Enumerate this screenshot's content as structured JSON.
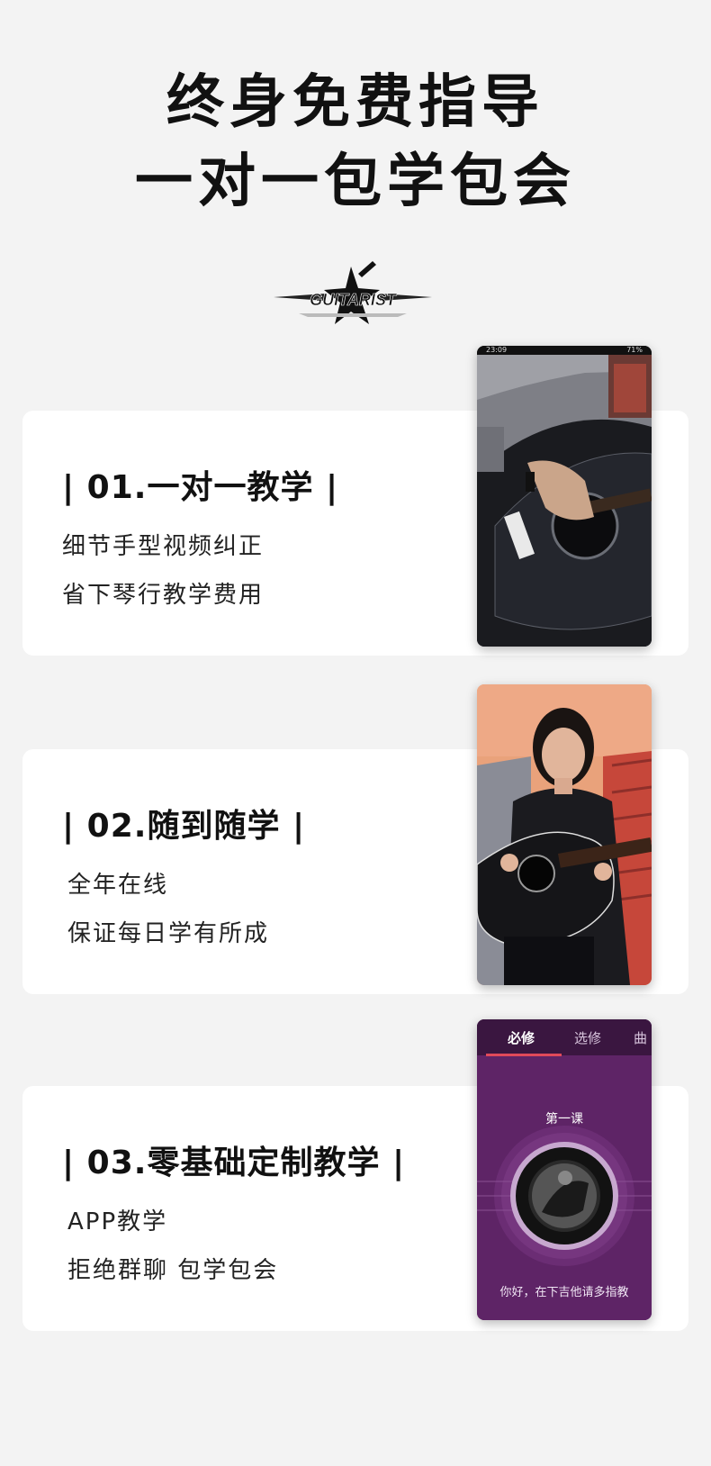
{
  "headline": {
    "line1": "终身免费指导",
    "line2": "一对一包学包会"
  },
  "logo": {
    "text": "GUITARIST"
  },
  "features": [
    {
      "title": "| 01.一对一教学 |",
      "lines": [
        "细节手型视频纠正",
        "省下琴行教学费用"
      ]
    },
    {
      "title": "|  02.随到随学  |",
      "lines": [
        "全年在线",
        "保证每日学有所成"
      ]
    },
    {
      "title": "| 03.零基础定制教学 |",
      "lines": [
        "APP教学",
        "拒绝群聊 包学包会"
      ]
    }
  ],
  "phone1": {
    "status_time": "23:09",
    "status_battery": "71%"
  },
  "app_screen": {
    "tabs": [
      "必修",
      "选修",
      "曲"
    ],
    "lesson_title": "第一课",
    "caption": "你好，在下吉他请多指教"
  },
  "colors": {
    "background": "#f3f3f3",
    "card": "#ffffff",
    "app_purple": "#5e2466",
    "tab_accent": "#e04a5a"
  }
}
